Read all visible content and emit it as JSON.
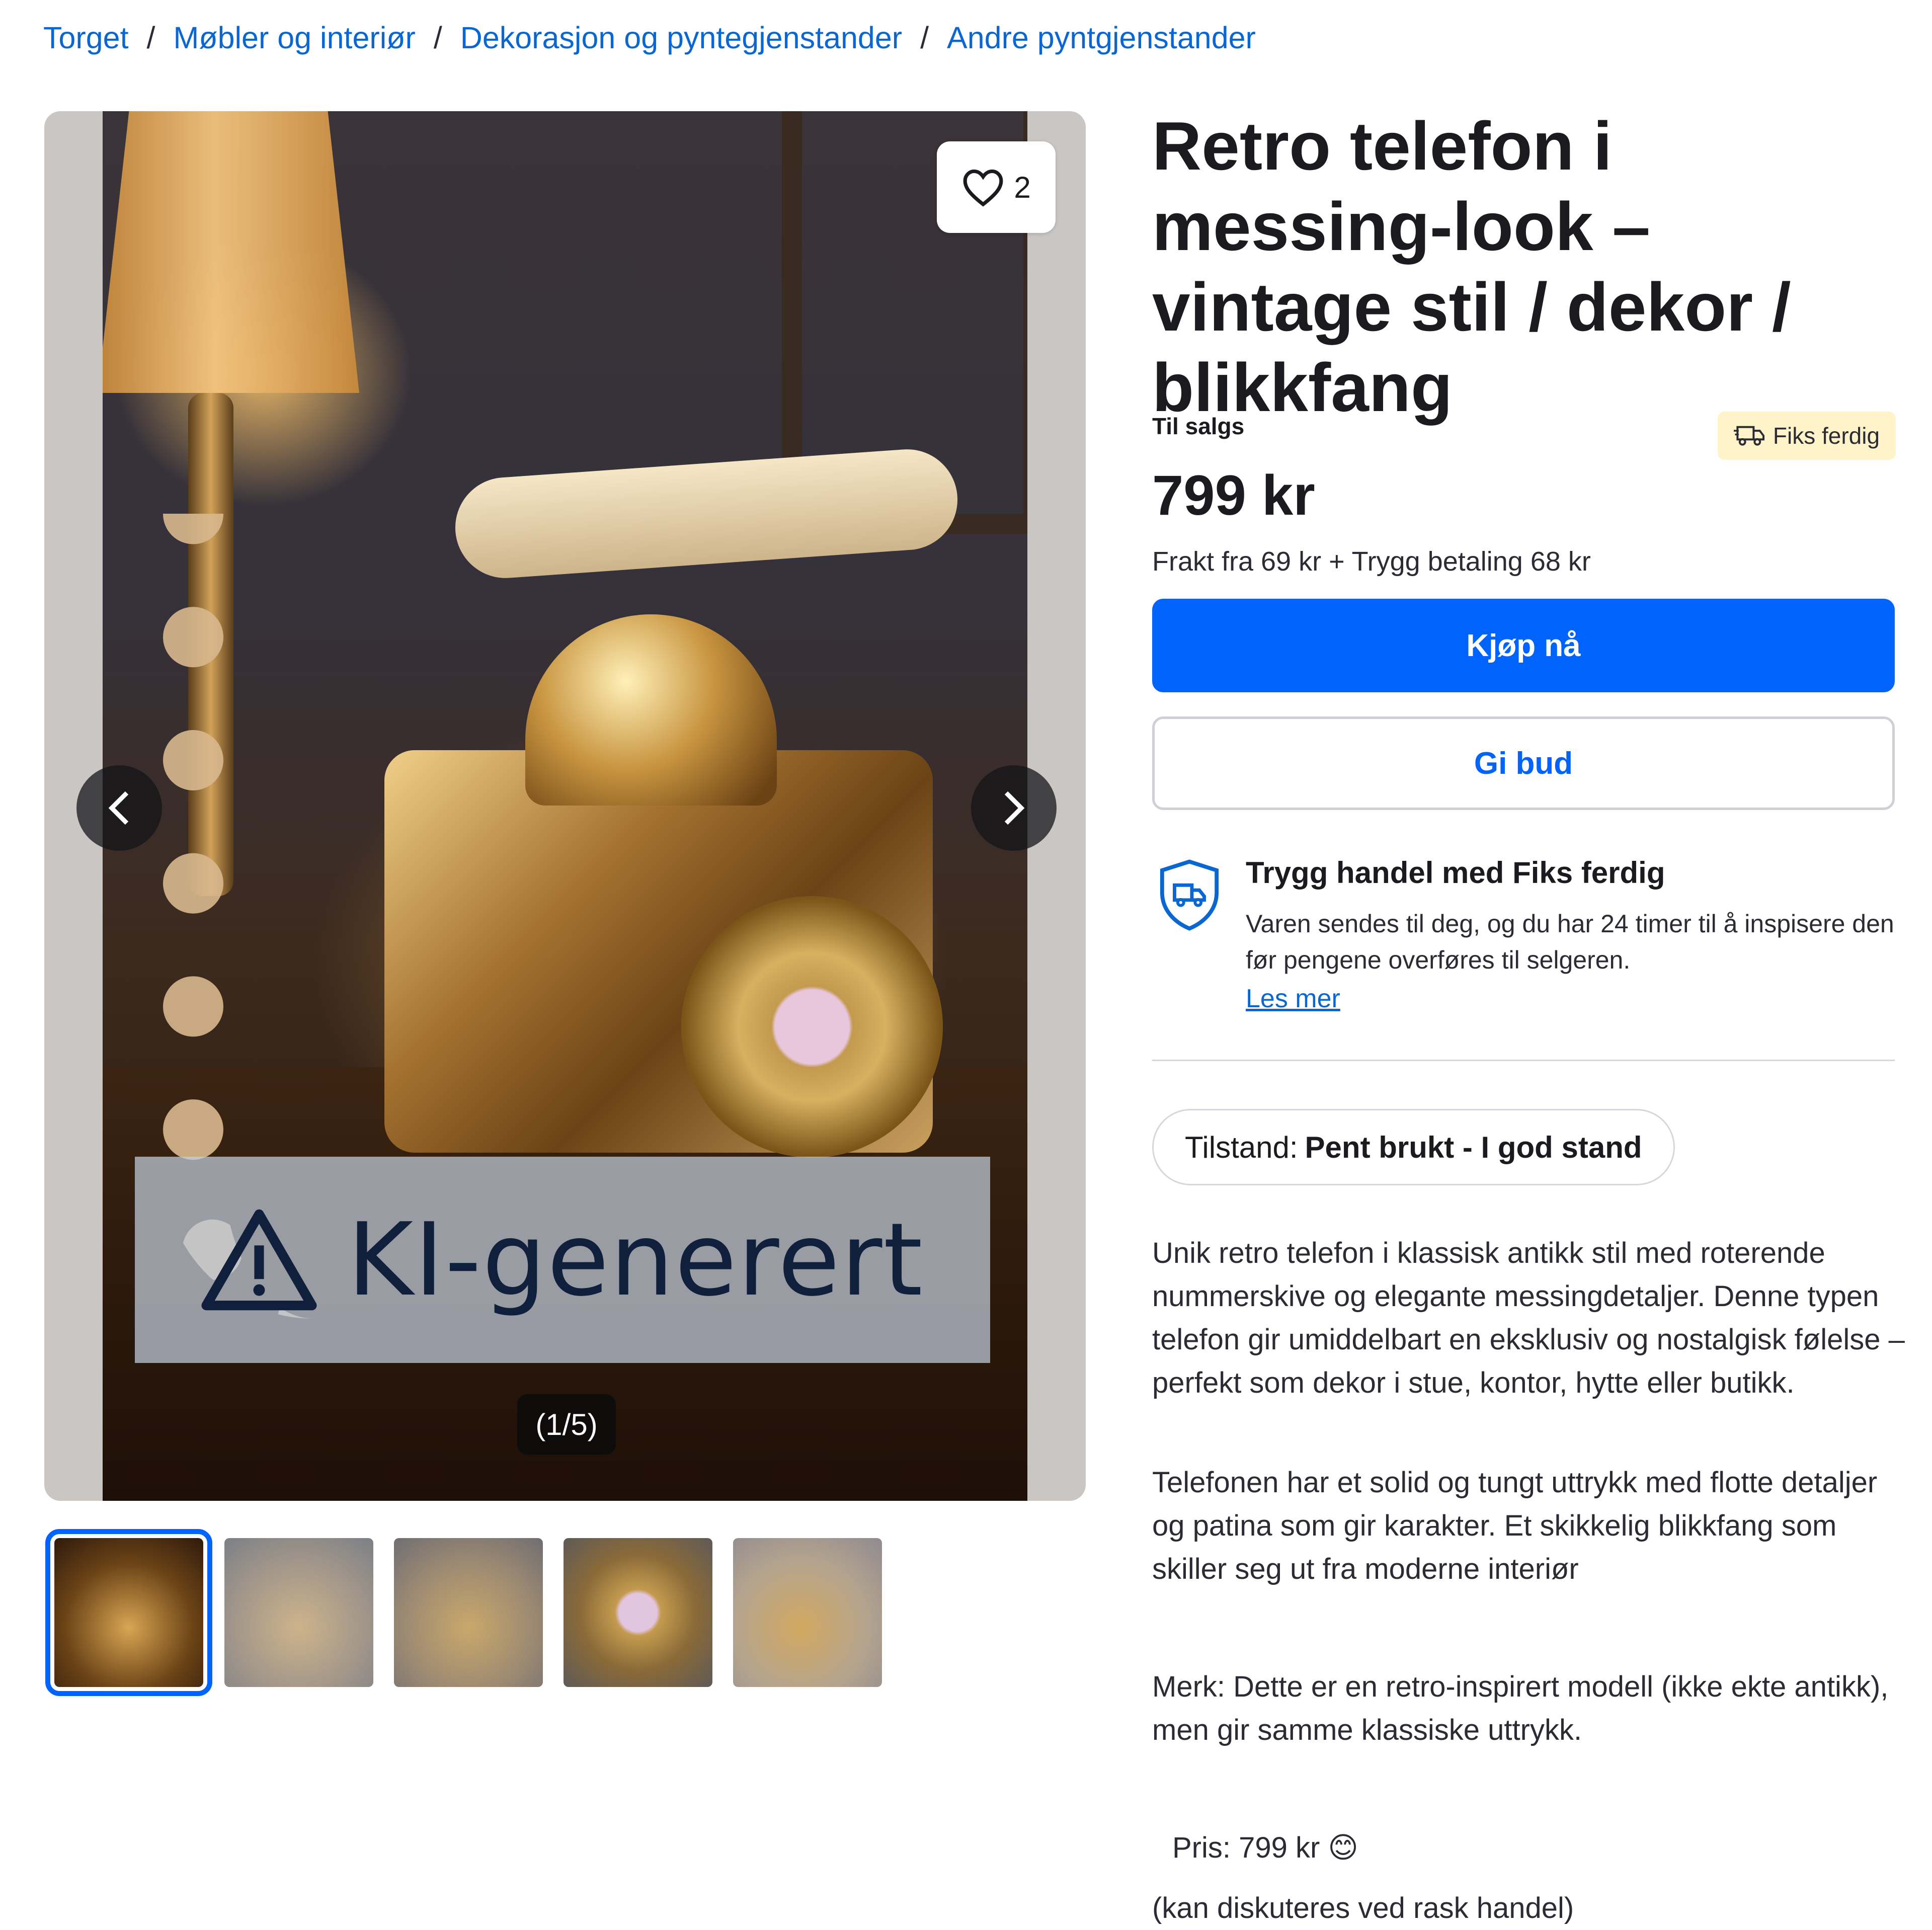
{
  "breadcrumb": [
    "Torget",
    "Møbler og interiør",
    "Dekorasjon og pyntegjenstander",
    "Andre pyntgjenstander"
  ],
  "gallery": {
    "favorite_count": "2",
    "ai_label": "KI-generert",
    "counter": "(1/5)",
    "thumbnail_count": 5,
    "selected_thumbnail": 1
  },
  "listing": {
    "title": "Retro telefon i messing-look – vintage stil / dekor / blikkfang",
    "status": "Til salgs",
    "badge": "Fiks ferdig",
    "price": "799 kr",
    "shipping": "Frakt fra 69 kr + Trygg betaling 68 kr",
    "buy_label": "Kjøp nå",
    "bid_label": "Gi bud"
  },
  "trust": {
    "title": "Trygg handel med Fiks ferdig",
    "body": "Varen sendes til deg, og du har 24 timer til å inspisere den før pengene overføres til selgeren.",
    "link": "Les mer"
  },
  "condition": {
    "label": "Tilstand:",
    "value": "Pent brukt - I god stand"
  },
  "description": [
    "Unik retro telefon i klassisk antikk stil med roterende nummerskive og elegante messingdetaljer. Denne typen telefon gir umiddelbart en eksklusiv og nostalgisk følelse – perfekt som dekor i stue, kontor, hytte eller butikk.",
    "Telefonen har et solid og tungt uttrykk med flotte detaljer og patina som gir karakter. Et skikkelig blikkfang som skiller seg ut fra moderne interiør",
    "Merk: Dette er en retro-inspirert modell (ikke ekte antikk), men gir samme klassiske uttrykk.",
    "Pris: 799 kr 😊",
    "(kan diskuteres ved rask handel)"
  ],
  "colors": {
    "accent": "#0063fb",
    "link": "#0a67d2",
    "badge_bg": "#fff3c9"
  }
}
